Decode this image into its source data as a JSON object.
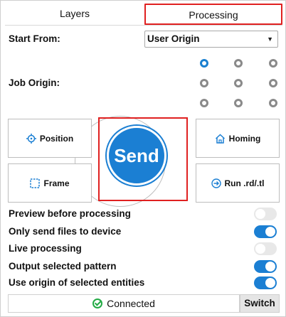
{
  "tabs": [
    {
      "label": "Layers",
      "active": false
    },
    {
      "label": "Processing",
      "active": true
    }
  ],
  "start_from": {
    "label": "Start From:",
    "value": "User Origin"
  },
  "job_origin": {
    "label": "Job Origin:",
    "selected_index": 0
  },
  "controls": {
    "position": "Position",
    "frame": "Frame",
    "homing": "Homing",
    "run": "Run .rd/.tl",
    "send": "Send"
  },
  "options": [
    {
      "label": "Preview before processing",
      "on": false
    },
    {
      "label": "Only send files to device",
      "on": true
    },
    {
      "label": "Live processing",
      "on": false
    },
    {
      "label": "Output selected pattern",
      "on": true
    },
    {
      "label": "Use origin of selected entities",
      "on": true
    }
  ],
  "status": {
    "text": "Connected",
    "switch_label": "Switch"
  },
  "colors": {
    "accent": "#1b7fd3",
    "highlight": "#e02020",
    "ok": "#22aa44"
  }
}
